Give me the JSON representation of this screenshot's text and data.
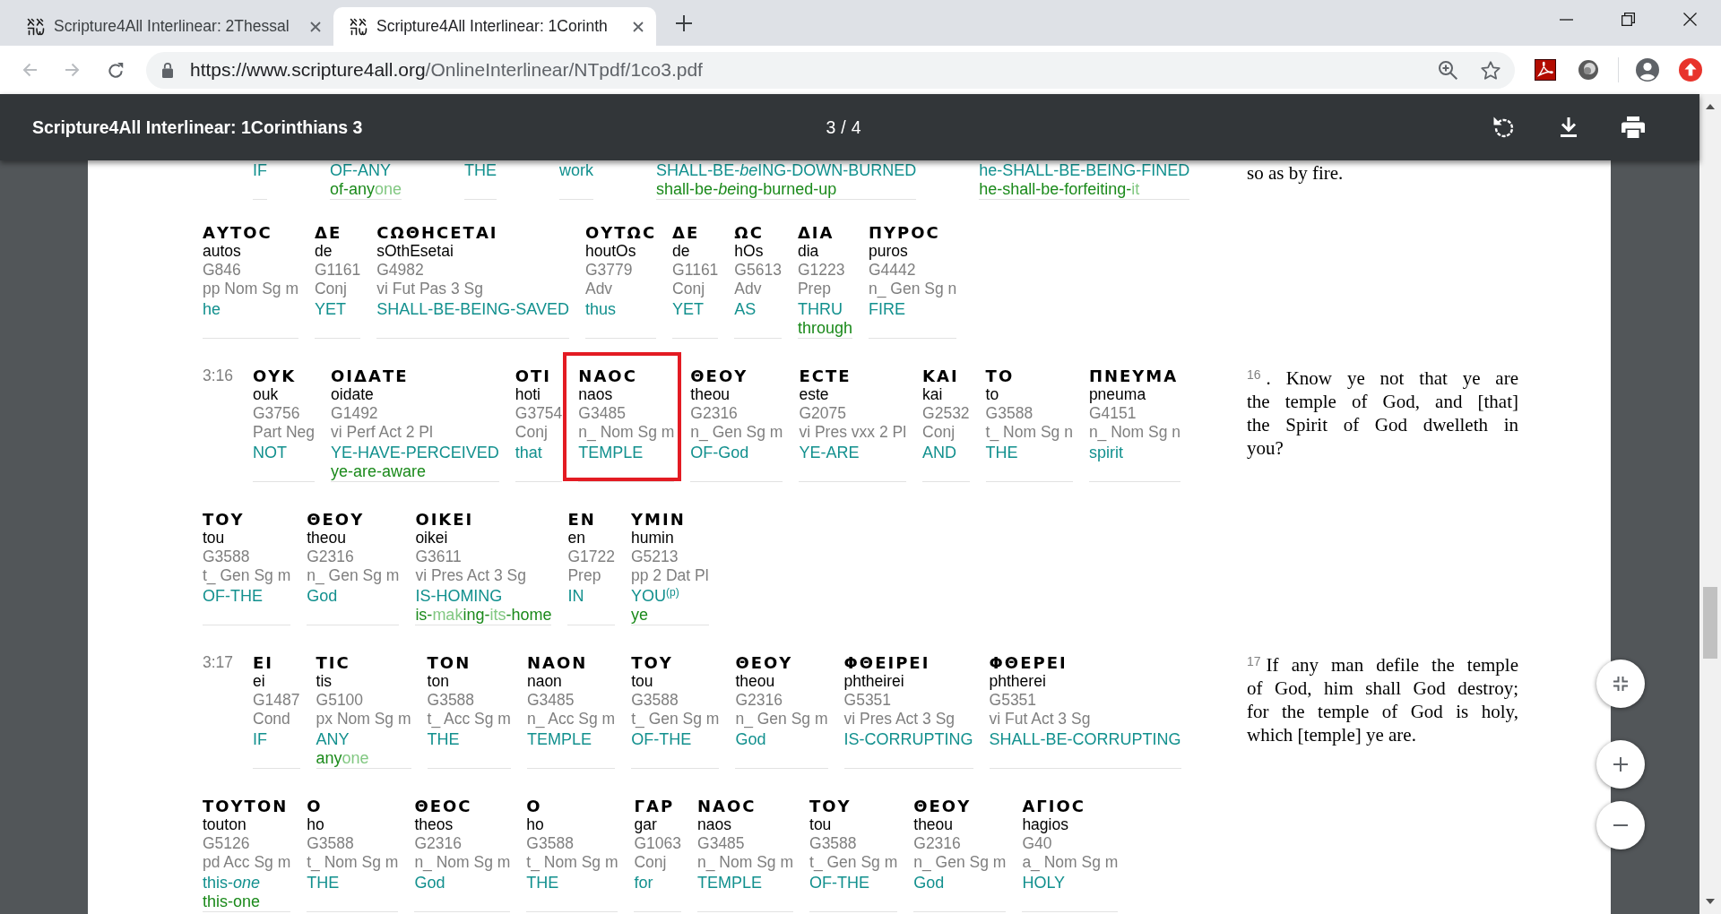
{
  "browser": {
    "tabs": [
      {
        "title": "Scripture4All Interlinear: 2Thessal",
        "selected": false
      },
      {
        "title": "Scripture4All Interlinear: 1Corinth",
        "selected": true
      }
    ],
    "nav_buttons": [
      {
        "kind": "back",
        "disabled": true
      },
      {
        "kind": "forward",
        "disabled": true
      },
      {
        "kind": "reload",
        "disabled": false
      }
    ],
    "url": {
      "host": "https://www.scripture4all.org",
      "path": "/OnlineInterlinear/NTpdf/1co3.pdf"
    }
  },
  "pdf_viewer": {
    "title": "Scripture4All Interlinear: 1Corinthians 3",
    "page": "3",
    "page_separator": "/",
    "page_count": "4"
  },
  "document": {
    "sections": [
      {
        "rows": [
          {
            "kind": "partial",
            "words": [
              {
                "gloss": [
                  "IF"
                ],
                "highlighted": false
              },
              {
                "gloss": [
                  "OF-ANY"
                ],
                "literal": [
                  {
                    "text": "of-any",
                    "implied": false
                  },
                  {
                    "text": "one",
                    "implied": true
                  }
                ],
                "highlighted": false
              },
              {
                "gloss": [
                  "THE"
                ],
                "highlighted": false
              },
              {
                "gloss": [
                  "work"
                ],
                "highlighted": false
              },
              {
                "gloss": [
                  "SHALL-BE-",
                  "*be*",
                  "ING-DOWN-BURNED"
                ],
                "literal": [
                  {
                    "text": "shall-be-",
                    "implied": false
                  },
                  {
                    "text": "*be*",
                    "implied": false
                  },
                  {
                    "text": "ing-burned-up",
                    "implied": false
                  }
                ],
                "highlighted": false
              },
              {
                "gloss": [
                  "he-SHALL-BE-BEING-FINED"
                ],
                "literal": [
                  {
                    "text": "he-shall-be-forfeiting-",
                    "implied": false
                  },
                  {
                    "text": "it",
                    "implied": true
                  }
                ],
                "highlighted": false
              }
            ]
          },
          {
            "kind": "full",
            "words": [
              {
                "greek": "ΑΥΤΟϹ",
                "translit": "autos",
                "strong": "G846",
                "morph": "pp Nom Sg m",
                "gloss": [
                  "he"
                ],
                "highlighted": false
              },
              {
                "greek": "ΔΕ",
                "translit": "de",
                "strong": "G1161",
                "morph": "Conj",
                "gloss": [
                  "YET"
                ],
                "highlighted": false
              },
              {
                "greek": "ϹΩΘΗϹΕΤΑΙ",
                "translit": "sOthEsetai",
                "strong": "G4982",
                "morph": "vi Fut Pas 3 Sg",
                "gloss": [
                  "SHALL-BE-BEING-SAVED"
                ],
                "highlighted": false
              },
              {
                "greek": "ΟΥΤΩϹ",
                "translit": "houtOs",
                "strong": "G3779",
                "morph": "Adv",
                "gloss": [
                  "thus"
                ],
                "highlighted": false
              },
              {
                "greek": "ΔΕ",
                "translit": "de",
                "strong": "G1161",
                "morph": "Conj",
                "gloss": [
                  "YET"
                ],
                "highlighted": false
              },
              {
                "greek": "ΩϹ",
                "translit": "hOs",
                "strong": "G5613",
                "morph": "Adv",
                "gloss": [
                  "AS"
                ],
                "highlighted": false
              },
              {
                "greek": "ΔΙΑ",
                "translit": "dia",
                "strong": "G1223",
                "morph": "Prep",
                "gloss": [
                  "THRU"
                ],
                "literal": [
                  {
                    "text": "through",
                    "implied": false
                  }
                ],
                "highlighted": false
              },
              {
                "greek": "ΠΥΡΟϹ",
                "translit": "puros",
                "strong": "G4442",
                "morph": "n_ Gen Sg n",
                "gloss": [
                  "FIRE"
                ],
                "highlighted": false
              }
            ]
          }
        ],
        "verse_text": {
          "lines": [
            "so as by fire."
          ]
        }
      },
      {
        "rows": [
          {
            "kind": "full",
            "verse": "3:16",
            "words": [
              {
                "greek": "ΟΥΚ",
                "translit": "ouk",
                "strong": "G3756",
                "morph": "Part Neg",
                "gloss": [
                  "NOT"
                ],
                "highlighted": false
              },
              {
                "greek": "ΟΙΔΑΤΕ",
                "translit": "oidate",
                "strong": "G1492",
                "morph": "vi Perf Act 2 Pl",
                "gloss": [
                  "YE-HAVE-PERCEIVED"
                ],
                "literal": [
                  {
                    "text": "ye-are-aware",
                    "implied": false
                  }
                ],
                "highlighted": false
              },
              {
                "greek": "ΟΤΙ",
                "translit": "hoti",
                "strong": "G3754",
                "morph": "Conj",
                "gloss": [
                  "that"
                ],
                "highlighted": false
              },
              {
                "greek": "ΝΑΟϹ",
                "translit": "naos",
                "strong": "G3485",
                "morph": "n_ Nom Sg m",
                "gloss": [
                  "TEMPLE"
                ],
                "highlighted": true
              },
              {
                "greek": "ΘΕΟΥ",
                "translit": "theou",
                "strong": "G2316",
                "morph": "n_ Gen Sg m",
                "gloss": [
                  "OF-God"
                ],
                "highlighted": false
              },
              {
                "greek": "ΕϹΤΕ",
                "translit": "este",
                "strong": "G2075",
                "morph": "vi Pres vxx 2 Pl",
                "gloss": [
                  "YE-ARE"
                ],
                "highlighted": false
              },
              {
                "greek": "ΚΑΙ",
                "translit": "kai",
                "strong": "G2532",
                "morph": "Conj",
                "gloss": [
                  "AND"
                ],
                "highlighted": false
              },
              {
                "greek": "ΤΟ",
                "translit": "to",
                "strong": "G3588",
                "morph": "t_ Nom Sg n",
                "gloss": [
                  "THE"
                ],
                "highlighted": false
              },
              {
                "greek": "ΠΝΕΥΜΑ",
                "translit": "pneuma",
                "strong": "G4151",
                "morph": "n_ Nom Sg n",
                "gloss": [
                  "spirit"
                ],
                "highlighted": false
              }
            ]
          },
          {
            "kind": "full",
            "words": [
              {
                "greek": "ΤΟΥ",
                "translit": "tou",
                "strong": "G3588",
                "morph": "t_ Gen Sg m",
                "gloss": [
                  "OF-THE"
                ],
                "highlighted": false
              },
              {
                "greek": "ΘΕΟΥ",
                "translit": "theou",
                "strong": "G2316",
                "morph": "n_ Gen Sg m",
                "gloss": [
                  "God"
                ],
                "highlighted": false
              },
              {
                "greek": "ΟΙΚΕΙ",
                "translit": "oikei",
                "strong": "G3611",
                "morph": "vi Pres Act 3 Sg",
                "gloss": [
                  "IS-HOMING"
                ],
                "literal": [
                  {
                    "text": "is-",
                    "implied": false
                  },
                  {
                    "text": "mak",
                    "implied": true
                  },
                  {
                    "text": "ing-",
                    "implied": false
                  },
                  {
                    "text": "its",
                    "implied": true
                  },
                  {
                    "text": "-home",
                    "implied": false
                  }
                ],
                "highlighted": false
              },
              {
                "greek": "ΕΝ",
                "translit": "en",
                "strong": "G1722",
                "morph": "Prep",
                "gloss": [
                  "IN"
                ],
                "highlighted": false
              },
              {
                "greek": "ΥΜΙΝ",
                "translit": "humin",
                "strong": "G5213",
                "morph": "pp 2 Dat Pl",
                "gloss": [
                  "YOU$^{(p)}$"
                ],
                "literal": [
                  {
                    "text": "ye",
                    "implied": false
                  }
                ],
                "highlighted": false
              }
            ]
          }
        ],
        "verse_text": {
          "number": "16",
          "lines": [
            ". Know ye not that ye are",
            "the temple of God, and [that]",
            "the Spirit of God dwelleth in",
            "you?"
          ]
        }
      },
      {
        "rows": [
          {
            "kind": "full",
            "verse": "3:17",
            "words": [
              {
                "greek": "ΕΙ",
                "translit": "ei",
                "strong": "G1487",
                "morph": "Cond",
                "gloss": [
                  "IF"
                ],
                "highlighted": false
              },
              {
                "greek": "ΤΙϹ",
                "translit": "tis",
                "strong": "G5100",
                "morph": "px Nom Sg m",
                "gloss": [
                  "ANY"
                ],
                "literal": [
                  {
                    "text": "any",
                    "implied": false
                  },
                  {
                    "text": "one",
                    "implied": true
                  }
                ],
                "highlighted": false
              },
              {
                "greek": "ΤΟΝ",
                "translit": "ton",
                "strong": "G3588",
                "morph": "t_ Acc Sg m",
                "gloss": [
                  "THE"
                ],
                "highlighted": false
              },
              {
                "greek": "ΝΑΟΝ",
                "translit": "naon",
                "strong": "G3485",
                "morph": "n_ Acc Sg m",
                "gloss": [
                  "TEMPLE"
                ],
                "highlighted": false
              },
              {
                "greek": "ΤΟΥ",
                "translit": "tou",
                "strong": "G3588",
                "morph": "t_ Gen Sg m",
                "gloss": [
                  "OF-THE"
                ],
                "highlighted": false
              },
              {
                "greek": "ΘΕΟΥ",
                "translit": "theou",
                "strong": "G2316",
                "morph": "n_ Gen Sg m",
                "gloss": [
                  "God"
                ],
                "highlighted": false
              },
              {
                "greek": "ΦΘΕΙΡΕΙ",
                "translit": "phtheirei",
                "strong": "G5351",
                "morph": "vi Pres Act 3 Sg",
                "gloss": [
                  "IS-CORRUPTING"
                ],
                "highlighted": false
              },
              {
                "greek": "ΦΘΕΡΕΙ",
                "translit": "phtherei",
                "strong": "G5351",
                "morph": "vi Fut Act 3 Sg",
                "gloss": [
                  "SHALL-BE-CORRUPTING"
                ],
                "highlighted": false
              }
            ]
          },
          {
            "kind": "full",
            "words": [
              {
                "greek": "ΤΟΥΤΟΝ",
                "translit": "touton",
                "strong": "G5126",
                "morph": "pd Acc Sg m",
                "gloss": [
                  "this-*one*"
                ],
                "literal": [
                  {
                    "text": "this-one",
                    "implied": false
                  }
                ],
                "highlighted": false
              },
              {
                "greek": "Ο",
                "translit": "ho",
                "strong": "G3588",
                "morph": "t_ Nom Sg m",
                "gloss": [
                  "THE"
                ],
                "highlighted": false
              },
              {
                "greek": "ΘΕΟϹ",
                "translit": "theos",
                "strong": "G2316",
                "morph": "n_ Nom Sg m",
                "gloss": [
                  "God"
                ],
                "highlighted": false
              },
              {
                "greek": "Ο",
                "translit": "ho",
                "strong": "G3588",
                "morph": "t_ Nom Sg m",
                "gloss": [
                  "THE"
                ],
                "highlighted": false
              },
              {
                "greek": "ΓΑΡ",
                "translit": "gar",
                "strong": "G1063",
                "morph": "Conj",
                "gloss": [
                  "for"
                ],
                "highlighted": false
              },
              {
                "greek": "ΝΑΟϹ",
                "translit": "naos",
                "strong": "G3485",
                "morph": "n_ Nom Sg m",
                "gloss": [
                  "TEMPLE"
                ],
                "highlighted": false
              },
              {
                "greek": "ΤΟΥ",
                "translit": "tou",
                "strong": "G3588",
                "morph": "t_ Gen Sg m",
                "gloss": [
                  "OF-THE"
                ],
                "highlighted": false
              },
              {
                "greek": "ΘΕΟΥ",
                "translit": "theou",
                "strong": "G2316",
                "morph": "n_ Gen Sg m",
                "gloss": [
                  "God"
                ],
                "highlighted": false
              },
              {
                "greek": "ΑΓΙΟϹ",
                "translit": "hagios",
                "strong": "G40",
                "morph": "a_ Nom Sg m",
                "gloss": [
                  "HOLY"
                ],
                "highlighted": false
              }
            ]
          }
        ],
        "verse_text": {
          "number": "17",
          "lines": [
            "If any man defile the temple",
            "of God, him shall God destroy;",
            "for the temple of God is holy,",
            "which [temple] ye are."
          ]
        }
      }
    ]
  }
}
